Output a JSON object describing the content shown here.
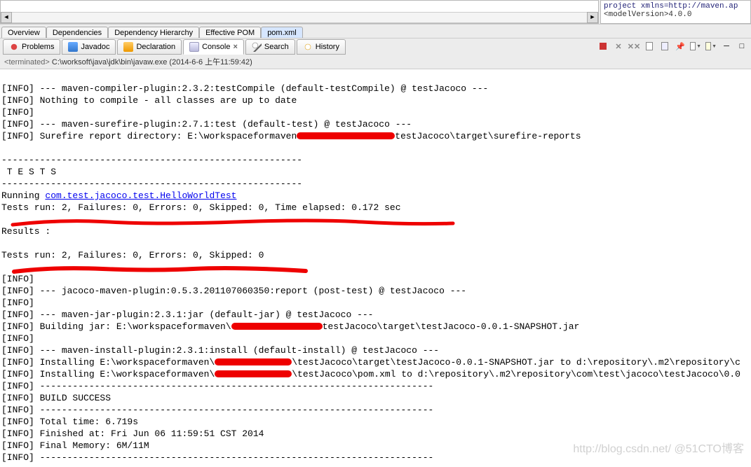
{
  "rightPane": {
    "line1": "project xmlns=http://maven.ap",
    "line2": "<modelVersion>4.0.0"
  },
  "subTabs": {
    "items": [
      {
        "label": "Overview"
      },
      {
        "label": "Dependencies"
      },
      {
        "label": "Dependency Hierarchy"
      },
      {
        "label": "Effective POM"
      },
      {
        "label": "pom.xml"
      }
    ],
    "activeIndex": 4
  },
  "viewTabs": {
    "items": [
      {
        "label": "Problems",
        "icon": "ico-problems"
      },
      {
        "label": "Javadoc",
        "icon": "ico-javadoc"
      },
      {
        "label": "Declaration",
        "icon": "ico-decl"
      },
      {
        "label": "Console",
        "icon": "ico-console",
        "closable": true
      },
      {
        "label": "Search",
        "icon": "ico-search"
      },
      {
        "label": "History",
        "icon": "ico-history"
      }
    ],
    "activeIndex": 3
  },
  "termLine": {
    "prefix": "terminated> ",
    "path": "C:\\worksoft\\java\\jdk\\bin\\javaw.exe (2014-6-6 上午11:59:42)"
  },
  "c": {
    "l1": "[INFO] --- maven-compiler-plugin:2.3.2:testCompile (default-testCompile) @ testJacoco ---",
    "l2": "[INFO] Nothing to compile - all classes are up to date",
    "l3": "[INFO]",
    "l4": "[INFO] --- maven-surefire-plugin:2.7.1:test (default-test) @ testJacoco ---",
    "l5a": "[INFO] Surefire report directory: E:\\workspaceformaven",
    "l5b": "testJacoco\\target\\surefire-reports",
    "l6": "",
    "l7": "-------------------------------------------------------",
    "l8": " T E S T S",
    "l9": "-------------------------------------------------------",
    "l10a": "Running ",
    "l10b": "com.test.jacoco.test.HelloWorldTest",
    "l11": "Tests run: 2, Failures: 0, Errors: 0, Skipped: 0, Time elapsed: 0.172 sec",
    "l12": "",
    "l13": "Results :",
    "l14": "",
    "l15": "Tests run: 2, Failures: 0, Errors: 0, Skipped: 0",
    "l16": "",
    "l17": "[INFO]",
    "l18": "[INFO] --- jacoco-maven-plugin:0.5.3.201107060350:report (post-test) @ testJacoco ---",
    "l19": "[INFO]",
    "l20": "[INFO] --- maven-jar-plugin:2.3.1:jar (default-jar) @ testJacoco ---",
    "l21a": "[INFO] Building jar: E:\\workspaceformaven\\",
    "l21b": "testJacoco\\target\\testJacoco-0.0.1-SNAPSHOT.jar",
    "l22": "[INFO]",
    "l23": "[INFO] --- maven-install-plugin:2.3.1:install (default-install) @ testJacoco ---",
    "l24a": "[INFO] Installing E:\\workspaceformaven\\",
    "l24b": "\\testJacoco\\target\\testJacoco-0.0.1-SNAPSHOT.jar to d:\\repository\\.m2\\repository\\c",
    "l25a": "[INFO] Installing E:\\workspaceformaven\\",
    "l25b": "\\testJacoco\\pom.xml to d:\\repository\\.m2\\repository\\com\\test\\jacoco\\testJacoco\\0.0",
    "l26": "[INFO] ------------------------------------------------------------------------",
    "l27": "[INFO] BUILD SUCCESS",
    "l28": "[INFO] ------------------------------------------------------------------------",
    "l29": "[INFO] Total time: 6.719s",
    "l30": "[INFO] Finished at: Fri Jun 06 11:59:51 CST 2014",
    "l31": "[INFO] Final Memory: 6M/11M",
    "l32": "[INFO] ------------------------------------------------------------------------"
  },
  "watermark": "http://blog.csdn.net/  @51CTO博客"
}
